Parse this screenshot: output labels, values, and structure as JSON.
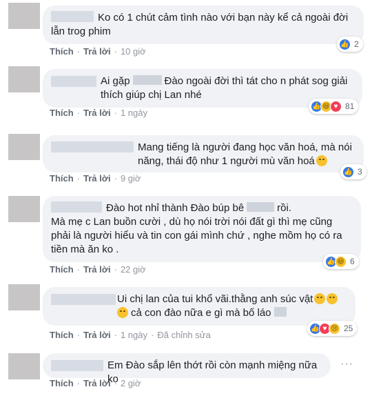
{
  "comments": [
    {
      "text": "Ko có 1 chút cảm tình nào với bạn này kể cả ngoài đời lẫn trog phim",
      "like_label": "Thích",
      "reply_label": "Trả lời",
      "time": "10 giờ",
      "reaction_count": "2",
      "reactions": [
        "like"
      ]
    },
    {
      "text_parts": [
        "Ai gặp",
        "Đào ngoài đời thì tát cho n phát sog giải thích giúp chị Lan nhé"
      ],
      "like_label": "Thích",
      "reply_label": "Trả lời",
      "time": "1 ngày",
      "reaction_count": "81",
      "reactions": [
        "like",
        "haha",
        "love"
      ]
    },
    {
      "text": "Mang tiếng là người đang học văn hoá, mà nói năng, thái độ như 1 người mù văn hoá",
      "like_label": "Thích",
      "reply_label": "Trả lời",
      "time": "9 giờ",
      "reaction_count": "3",
      "reactions": [
        "like"
      ]
    },
    {
      "text_parts": [
        "Đào hot nhỉ thành Đào búp bê",
        "rồi."
      ],
      "text_rest": "Mà mẹ c Lan buồn cười , dù họ nói trời nói đất gì thì mẹ cũng phải là người hiểu và tin con gái mình chứ , nghe mồm họ có ra tiền mà ăn ko .",
      "like_label": "Thích",
      "reply_label": "Trả lời",
      "time": "22 giờ",
      "reaction_count": "6",
      "reactions": [
        "like",
        "haha"
      ]
    },
    {
      "text_parts": [
        "Ui chị lan của tui khổ vãi.thằng anh súc vật",
        "cả con đào nữa e gì mà bố láo"
      ],
      "like_label": "Thích",
      "reply_label": "Trả lời",
      "time": "1 ngày",
      "edited": "Đã chỉnh sửa",
      "reaction_count": "25",
      "reactions": [
        "like",
        "love",
        "sad"
      ]
    },
    {
      "text": "Em Đào sắp lên thớt rồi còn mạnh miệng nữa ko",
      "like_label": "Thích",
      "reply_label": "Trả lời",
      "time": "2 giờ",
      "more": "···"
    }
  ],
  "colors": {
    "bubble_bg": "#f0f2f5",
    "like_blue": "#3578e5",
    "love_red": "#f33e58",
    "emoji_yellow": "#f7c22e"
  }
}
